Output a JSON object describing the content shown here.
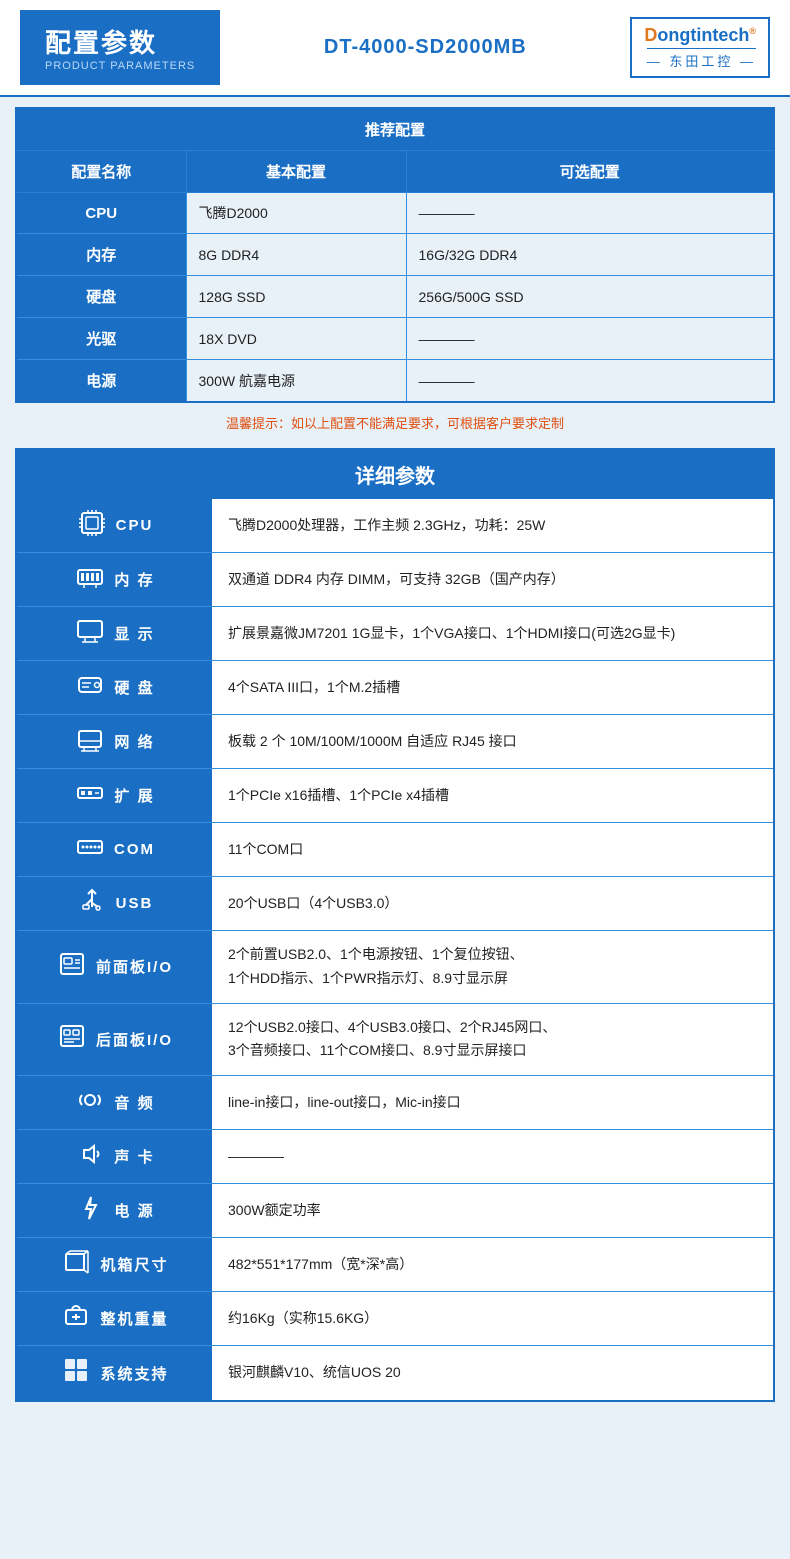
{
  "header": {
    "title": "配置参数",
    "subtitle": "PRODUCT PARAMETERS",
    "model": "DT-4000-SD2000MB"
  },
  "logo": {
    "brand": "Dongtintech",
    "brand_d": "D",
    "brand_rest": "ongtintech",
    "reg": "®",
    "sub": "— 东田工控 —"
  },
  "recommend": {
    "section_title": "推荐配置",
    "col1": "配置名称",
    "col2": "基本配置",
    "col3": "可选配置",
    "rows": [
      {
        "name": "CPU",
        "basic": "飞腾D2000",
        "optional": "————"
      },
      {
        "name": "内存",
        "basic": "8G DDR4",
        "optional": "16G/32G DDR4"
      },
      {
        "name": "硬盘",
        "basic": "128G SSD",
        "optional": "256G/500G SSD"
      },
      {
        "name": "光驱",
        "basic": "18X DVD",
        "optional": "————"
      },
      {
        "name": "电源",
        "basic": "300W 航嘉电源",
        "optional": "————"
      }
    ],
    "tip": "温馨提示：如以上配置不能满足要求，可根据客户要求定制"
  },
  "detail": {
    "section_title": "详细参数",
    "rows": [
      {
        "icon": "🖥",
        "label": "CPU",
        "value": "飞腾D2000处理器，工作主频 2.3GHz，功耗：25W"
      },
      {
        "icon": "📦",
        "label": "内  存",
        "value": "双通道 DDR4 内存 DIMM，可支持 32GB（国产内存）"
      },
      {
        "icon": "🖱",
        "label": "显  示",
        "value": "扩展景嘉微JM7201 1G显卡，1个VGA接口、1个HDMI接口(可选2G显卡)"
      },
      {
        "icon": "💾",
        "label": "硬  盘",
        "value": "4个SATA III口，1个M.2插槽"
      },
      {
        "icon": "📁",
        "label": "网  络",
        "value": "板载 2 个 10M/100M/1000M 自适应 RJ45 接口"
      },
      {
        "icon": "🔌",
        "label": "扩  展",
        "value": "1个PCIe x16插槽、1个PCIe x4插槽"
      },
      {
        "icon": "⌨",
        "label": "COM",
        "value": "11个COM口"
      },
      {
        "icon": "🔗",
        "label": "USB",
        "value": "20个USB口（4个USB3.0）"
      },
      {
        "icon": "📋",
        "label": "前面板I/O",
        "value": "2个前置USB2.0、1个电源按钮、1个复位按钮、\n1个HDD指示、1个PWR指示灯、8.9寸显示屏"
      },
      {
        "icon": "📋",
        "label": "后面板I/O",
        "value": "12个USB2.0接口、4个USB3.0接口、2个RJ45网口、\n3个音频接口、11个COM接口、8.9寸显示屏接口"
      },
      {
        "icon": "🔊",
        "label": "音  频",
        "value": "line-in接口，line-out接口，Mic-in接口"
      },
      {
        "icon": "🔊",
        "label": "声  卡",
        "value": "————"
      },
      {
        "icon": "⚡",
        "label": "电  源",
        "value": "300W额定功率"
      },
      {
        "icon": "📐",
        "label": "机箱尺寸",
        "value": "482*551*177mm（宽*深*高）"
      },
      {
        "icon": "⚖",
        "label": "整机重量",
        "value": "约16Kg（实称15.6KG）"
      },
      {
        "icon": "🪟",
        "label": "系统支持",
        "value": "银河麒麟V10、统信UOS 20"
      }
    ]
  }
}
